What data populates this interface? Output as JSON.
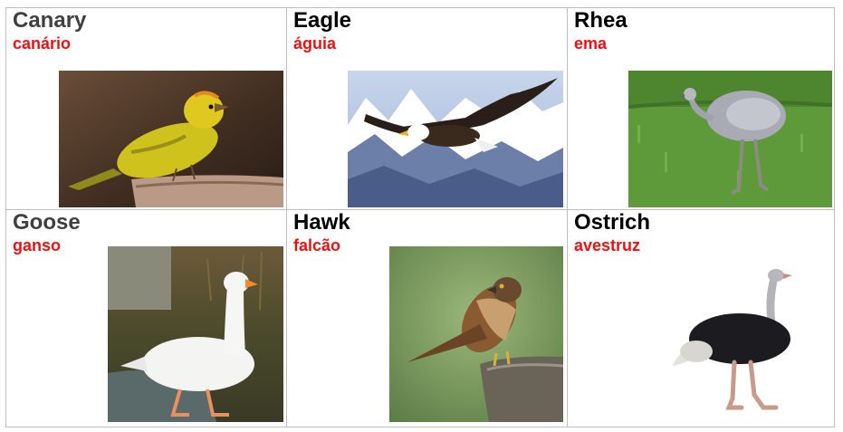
{
  "colors": {
    "english_name": "#000000",
    "english_name_dimmed": "#404040",
    "translation": "#ee1111",
    "cell_border": "#bfbfbf"
  },
  "cards": [
    {
      "english": "Canary",
      "portuguese": "canário",
      "photo": "canary-photo"
    },
    {
      "english": "Eagle",
      "portuguese": "águia",
      "photo": "eagle-photo"
    },
    {
      "english": "Rhea",
      "portuguese": "ema",
      "photo": "rhea-photo"
    },
    {
      "english": "Goose",
      "portuguese": "ganso",
      "photo": "goose-photo"
    },
    {
      "english": "Hawk",
      "portuguese": "falcão",
      "photo": "hawk-photo"
    },
    {
      "english": "Ostrich",
      "portuguese": "avestruz",
      "photo": "ostrich-photo"
    }
  ]
}
